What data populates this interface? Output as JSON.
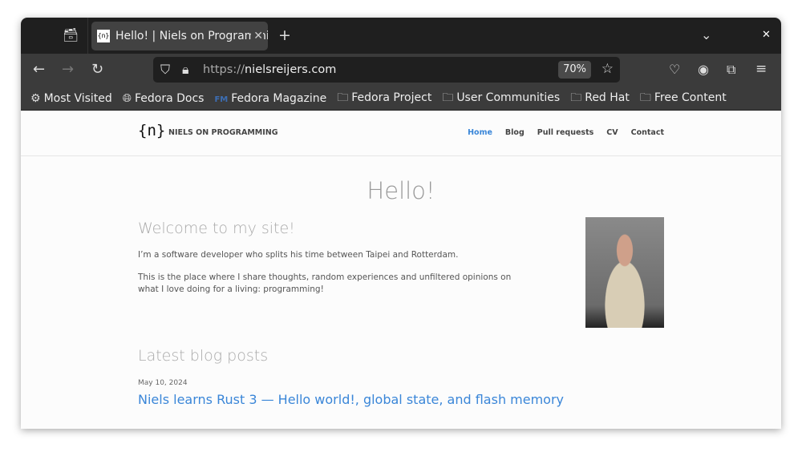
{
  "browser": {
    "tab": {
      "title": "Hello! | Niels on Programming",
      "favicon": "{n}"
    },
    "new_tab_icon": "plus-icon",
    "url_prefix": "https://",
    "url_host": "nielsreijers.com",
    "zoom": "70%",
    "bookmarks": [
      {
        "label": "Most Visited",
        "icon": "gear-icon"
      },
      {
        "label": "Fedora Docs",
        "icon": "globe-icon"
      },
      {
        "label": "Fedora Magazine",
        "icon": "fm-icon"
      },
      {
        "label": "Fedora Project",
        "icon": "folder-icon"
      },
      {
        "label": "User Communities",
        "icon": "folder-icon"
      },
      {
        "label": "Red Hat",
        "icon": "folder-icon"
      },
      {
        "label": "Free Content",
        "icon": "folder-icon"
      }
    ]
  },
  "site": {
    "logo": "{n}",
    "brand": "NIELS ON PROGRAMMING",
    "nav": [
      "Home",
      "Blog",
      "Pull requests",
      "CV",
      "Contact"
    ],
    "title": "Hello!",
    "welcome": "Welcome to my site!",
    "intro1": "I’m a software developer who splits his time between Taipei and Rotterdam.",
    "intro2": "This is the place where I share thoughts, random experiences and unfiltered opinions on what I love doing for a living: programming!",
    "latest": "Latest blog posts",
    "post_date": "May 10, 2024",
    "post_title": "Niels learns Rust 3 — Hello world!, global state, and flash memory",
    "accent": "#3a86d8"
  }
}
